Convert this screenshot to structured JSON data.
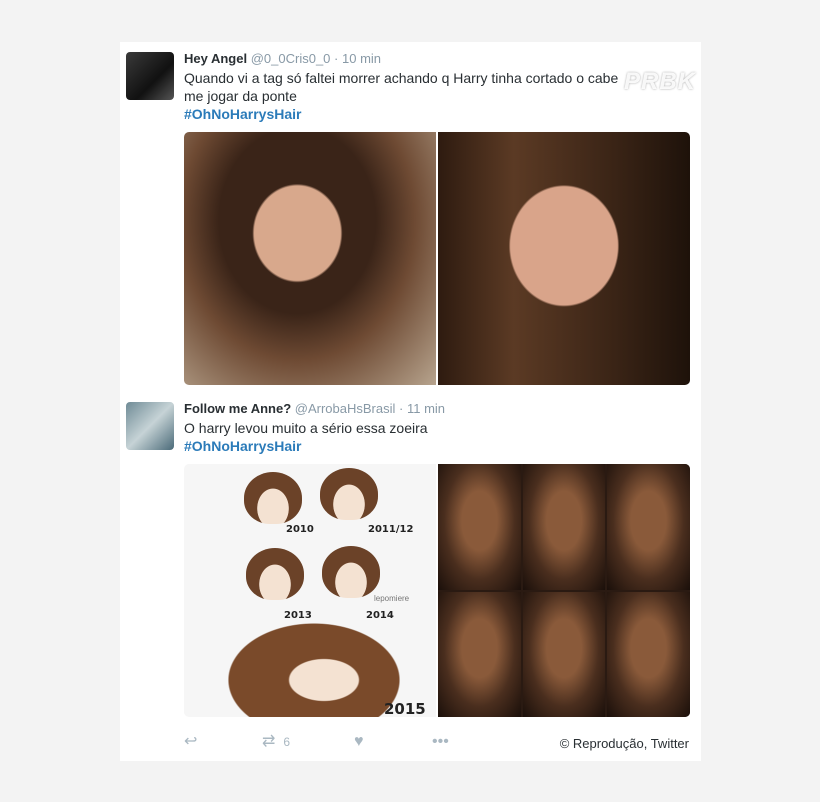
{
  "tweets": [
    {
      "name": "Hey Angel",
      "handle": "@0_0Cris0_0",
      "separator": "·",
      "time": "10 min",
      "text_line1": "Quando vi a tag só faltei morrer achando q Harry tinha cortado o cabe",
      "text_line2": "me jogar da ponte",
      "hashtag": "#OhNoHarrysHair"
    },
    {
      "name": "Follow me Anne?",
      "handle": "@ArrobaHsBrasil",
      "separator": "·",
      "time": "11 min",
      "text_line1": "O harry levou muito a sério essa zoeira",
      "hashtag": "#OhNoHarrysHair"
    }
  ],
  "drawing": {
    "years": [
      "2010",
      "2011/12",
      "2013",
      "2014",
      "2015"
    ],
    "signature": "lepomiere"
  },
  "actions": {
    "reply_icon": "reply-icon",
    "retweet_icon": "retweet-icon",
    "retweet_count": "6",
    "like_icon": "heart-icon",
    "more_icon": "more-icon"
  },
  "credit": "© Reprodução, Twitter",
  "watermark": "PRBK",
  "colors": {
    "hashtag": "#2b7bb9",
    "name": "#292f33",
    "meta": "#8899a6",
    "icon": "#aab8c2"
  }
}
